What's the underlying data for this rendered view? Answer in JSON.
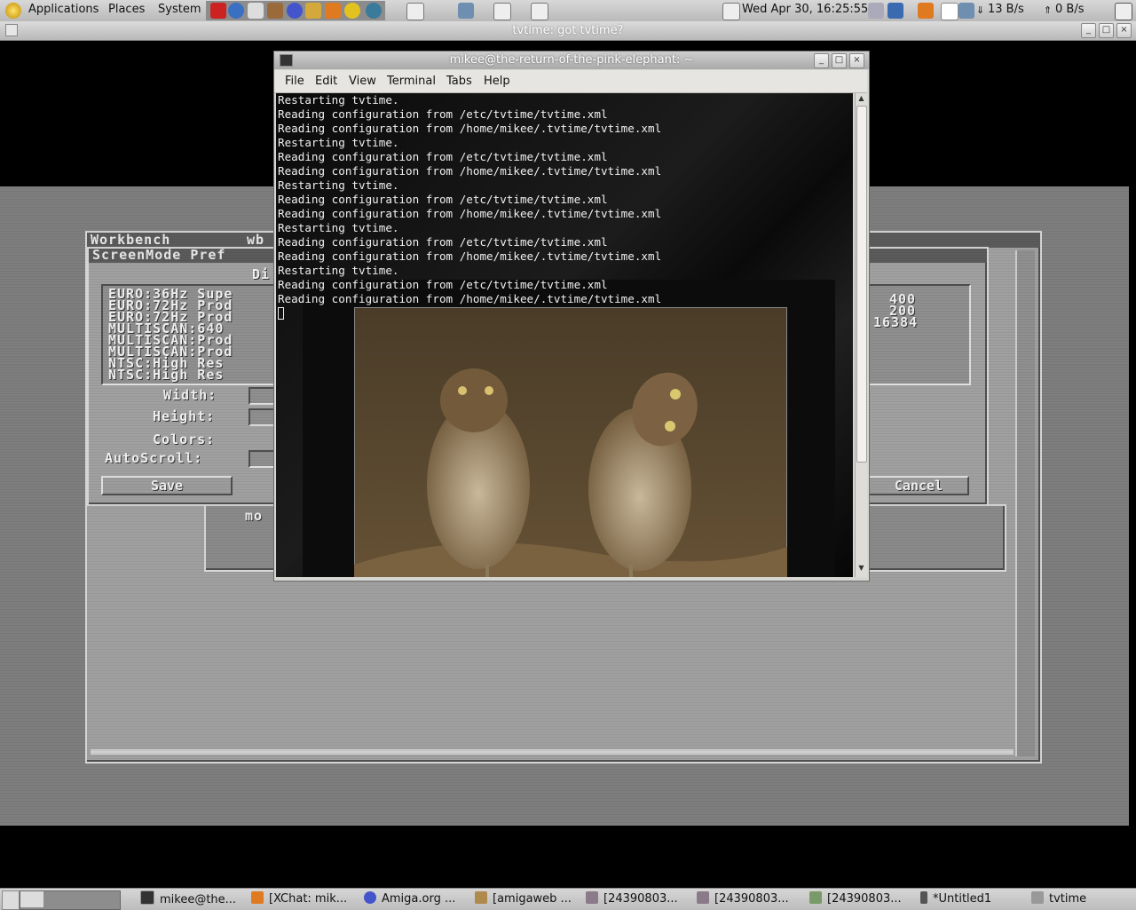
{
  "top_panel": {
    "menus": [
      "Applications",
      "Places",
      "System"
    ],
    "clock": "Wed Apr 30, 16:25:55",
    "net_down": "13 B/s",
    "net_up": "0 B/s"
  },
  "tvtime_window": {
    "title": "tvtime: got tvtime?"
  },
  "terminal": {
    "title": "mikee@the-return-of-the-pink-elephant: ~",
    "menus": [
      "File",
      "Edit",
      "View",
      "Terminal",
      "Tabs",
      "Help"
    ],
    "lines": [
      "Restarting tvtime.",
      "Reading configuration from /etc/tvtime/tvtime.xml",
      "Reading configuration from /home/mikee/.tvtime/tvtime.xml",
      "Restarting tvtime.",
      "Reading configuration from /etc/tvtime/tvtime.xml",
      "Reading configuration from /home/mikee/.tvtime/tvtime.xml",
      "Restarting tvtime.",
      "Reading configuration from /etc/tvtime/tvtime.xml",
      "Reading configuration from /home/mikee/.tvtime/tvtime.xml",
      "Restarting tvtime.",
      "Reading configuration from /etc/tvtime/tvtime.xml",
      "Reading configuration from /home/mikee/.tvtime/tvtime.xml",
      "Restarting tvtime.",
      "Reading configuration from /etc/tvtime/tvtime.xml",
      "Reading configuration from /home/mikee/.tvtime/tvtime.xml"
    ]
  },
  "amiga": {
    "workbench_title": "Workbench",
    "wb_tab": "wb",
    "screenmode_title": "ScreenMode Pref",
    "display_label": "Di",
    "modes": [
      "EURO:36Hz Supe",
      "EURO:72Hz Prod",
      "EURO:72Hz Prod",
      "MULTISCAN:640",
      "MULTISCAN:Prod",
      "MULTISCAN:Prod",
      "NTSC:High Res",
      "NTSC:High Res"
    ],
    "width_label": "Width:",
    "height_label": "Height:",
    "colors_label": "Colors:",
    "autoscroll_label": "AutoScroll:",
    "right_values": [
      "400",
      "200",
      "16384"
    ],
    "save_label": "Save",
    "cancel_label": "Cancel",
    "mo_text": "mo"
  },
  "taskbar": {
    "items": [
      {
        "label": "mikee@the...",
        "icon": "terminal-icon"
      },
      {
        "label": "[XChat: mik...",
        "icon": "xchat-icon"
      },
      {
        "label": "Amiga.org ...",
        "icon": "browser-icon"
      },
      {
        "label": "[amigaweb ...",
        "icon": "file-icon"
      },
      {
        "label": "[24390803...",
        "icon": "image-icon"
      },
      {
        "label": "[24390803...",
        "icon": "image-icon"
      },
      {
        "label": "[24390803...",
        "icon": "image-icon"
      },
      {
        "label": "*Untitled1",
        "icon": "pen-icon"
      },
      {
        "label": "tvtime",
        "icon": "tv-icon"
      }
    ]
  }
}
